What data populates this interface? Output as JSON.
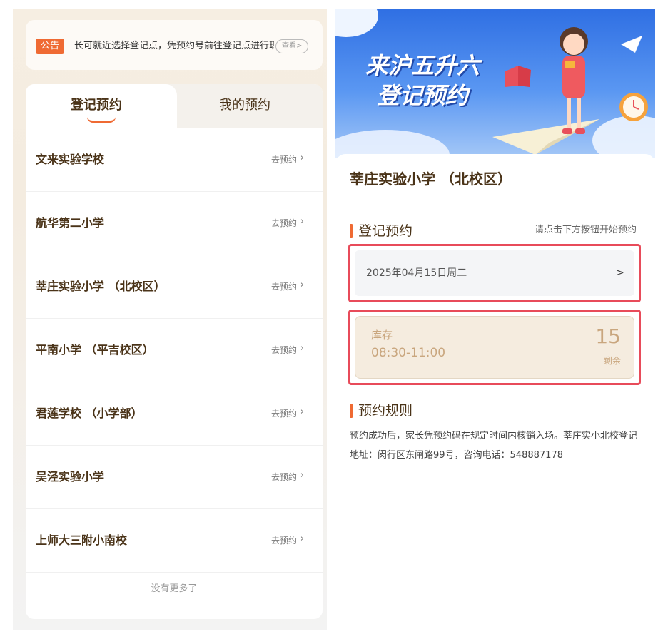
{
  "left": {
    "notice": {
      "tag": "公告",
      "text": "长可就近选择登记点，凭预约号前往登记点进行现场登记",
      "view_label": "查看>"
    },
    "tabs": [
      {
        "label": "登记预约",
        "active": true
      },
      {
        "label": "我的预约",
        "active": false
      }
    ],
    "schools": [
      {
        "name": "文来实验学校",
        "action": "去预约"
      },
      {
        "name": "航华第二小学",
        "action": "去预约"
      },
      {
        "name": "莘庄实验小学 （北校区）",
        "action": "去预约"
      },
      {
        "name": "平南小学 （平吉校区）",
        "action": "去预约"
      },
      {
        "name": "君莲学校 （小学部）",
        "action": "去预约"
      },
      {
        "name": "吴泾实验小学",
        "action": "去预约"
      },
      {
        "name": "上师大三附小南校",
        "action": "去预约"
      }
    ],
    "no_more": "没有更多了"
  },
  "right": {
    "banner": {
      "title_line1": "来沪五升六",
      "title_line2": "登记预约"
    },
    "school_title": "莘庄实验小学 （北校区）",
    "booking": {
      "section_title": "登记预约",
      "hint": "请点击下方按钮开始预约",
      "date": "2025年04月15日周二",
      "date_chevron": ">",
      "slot": {
        "label": "库存",
        "time": "08:30-11:00",
        "remaining": "15",
        "remaining_label": "剩余"
      }
    },
    "rules": {
      "section_title": "预约规则",
      "text": "预约成功后，家长凭预约码在规定时间内核销入场。莘庄实小北校登记地址：闵行区东闸路99号，咨询电话：548887178"
    }
  },
  "colors": {
    "accent": "#ef6a33",
    "title_brown": "#4a3318",
    "highlight_red": "#e84b5a",
    "slot_tan": "#c9a67e"
  }
}
